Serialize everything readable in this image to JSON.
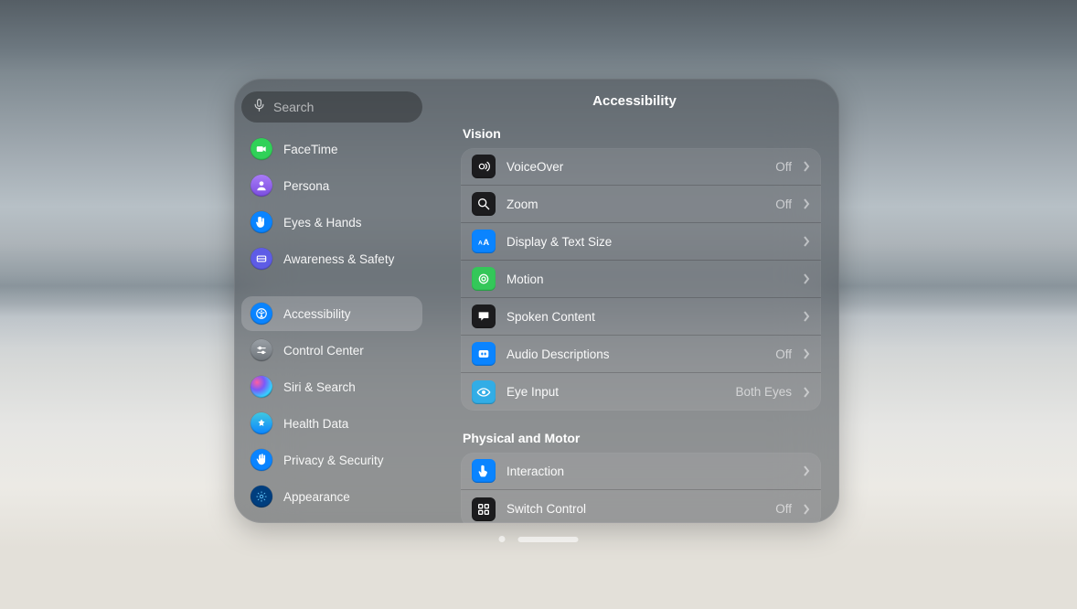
{
  "search": {
    "placeholder": "Search"
  },
  "sidebar": {
    "items": [
      {
        "label": "FaceTime"
      },
      {
        "label": "Persona"
      },
      {
        "label": "Eyes & Hands"
      },
      {
        "label": "Awareness & Safety"
      },
      {
        "label": "Accessibility"
      },
      {
        "label": "Control Center"
      },
      {
        "label": "Siri & Search"
      },
      {
        "label": "Health Data"
      },
      {
        "label": "Privacy & Security"
      },
      {
        "label": "Appearance"
      }
    ]
  },
  "main": {
    "title": "Accessibility",
    "sections": [
      {
        "title": "Vision",
        "rows": [
          {
            "label": "VoiceOver",
            "value": "Off"
          },
          {
            "label": "Zoom",
            "value": "Off"
          },
          {
            "label": "Display & Text Size",
            "value": ""
          },
          {
            "label": "Motion",
            "value": ""
          },
          {
            "label": "Spoken Content",
            "value": ""
          },
          {
            "label": "Audio Descriptions",
            "value": "Off"
          },
          {
            "label": "Eye Input",
            "value": "Both Eyes"
          }
        ]
      },
      {
        "title": "Physical and Motor",
        "rows": [
          {
            "label": "Interaction",
            "value": ""
          },
          {
            "label": "Switch Control",
            "value": "Off"
          }
        ]
      }
    ]
  }
}
